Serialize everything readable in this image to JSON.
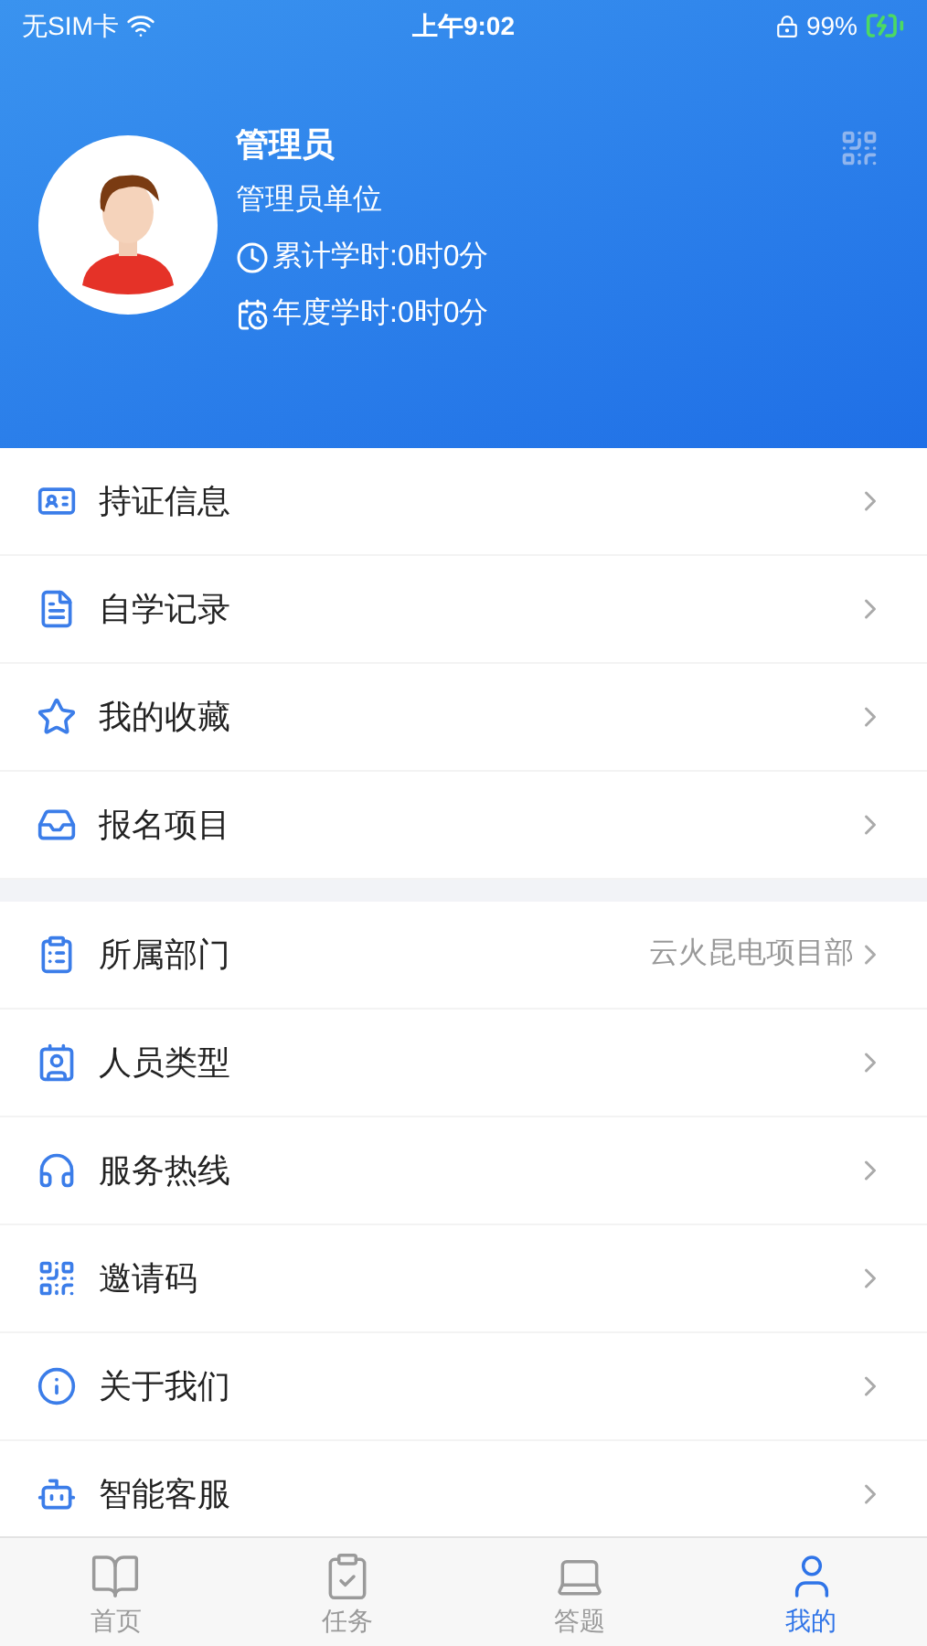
{
  "status_bar": {
    "carrier": "无SIM卡",
    "time": "上午9:02",
    "battery": "99%"
  },
  "profile": {
    "name": "管理员",
    "unit": "管理员单位",
    "total_hours": "累计学时:0时0分",
    "year_hours": "年度学时:0时0分"
  },
  "menu_groups": [
    {
      "items": [
        {
          "label": "持证信息"
        },
        {
          "label": "自学记录"
        },
        {
          "label": "我的收藏"
        },
        {
          "label": "报名项目"
        }
      ]
    },
    {
      "items": [
        {
          "label": "所属部门",
          "value": "云火昆电项目部"
        },
        {
          "label": "人员类型"
        },
        {
          "label": "服务热线"
        },
        {
          "label": "邀请码"
        },
        {
          "label": "关于我们"
        },
        {
          "label": "智能客服"
        }
      ]
    }
  ],
  "tabs": [
    {
      "label": "首页",
      "selected": false
    },
    {
      "label": "任务",
      "selected": false
    },
    {
      "label": "答题",
      "selected": false
    },
    {
      "label": "我的",
      "selected": true
    }
  ]
}
